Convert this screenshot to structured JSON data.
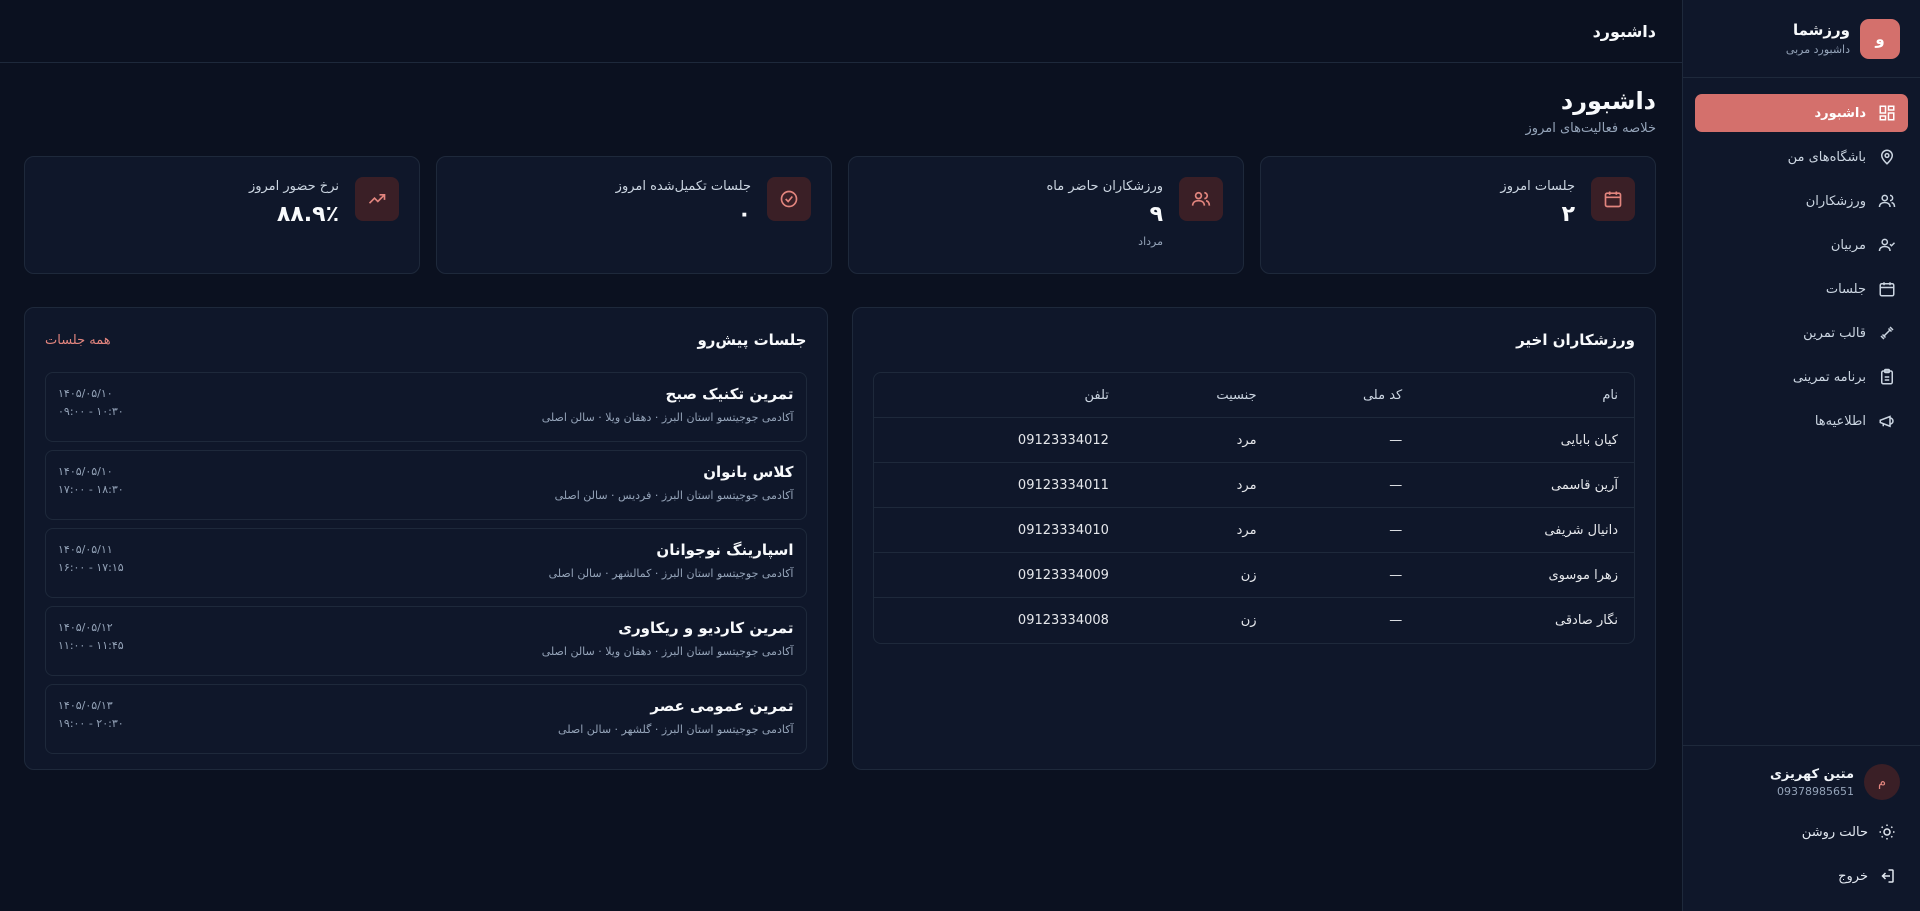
{
  "brand": {
    "name": "ورزشما",
    "subtitle": "داشبورد مربی",
    "logo_letter": "و"
  },
  "nav": [
    {
      "label": "داشبورد",
      "icon": "dashboard-grid-icon",
      "active": true
    },
    {
      "label": "باشگاه‌های من",
      "icon": "map-pin-icon"
    },
    {
      "label": "ورزشکاران",
      "icon": "users-icon"
    },
    {
      "label": "مربیان",
      "icon": "user-check-icon"
    },
    {
      "label": "جلسات",
      "icon": "calendar-icon"
    },
    {
      "label": "قالب تمرین",
      "icon": "dumbbell-icon"
    },
    {
      "label": "برنامه تمرینی",
      "icon": "clipboard-icon"
    },
    {
      "label": "اطلاعیه‌ها",
      "icon": "megaphone-icon"
    }
  ],
  "user": {
    "avatar_letter": "م",
    "name": "متین کهریزی",
    "phone": "09378985651"
  },
  "footer": {
    "theme_label": "حالت روشن",
    "logout_label": "خروج"
  },
  "topbar": {
    "title": "داشبورد"
  },
  "page": {
    "title": "داشبورد",
    "subtitle": "خلاصه فعالیت‌های امروز"
  },
  "stats": [
    {
      "label": "جلسات امروز",
      "value": "۲",
      "note": "",
      "icon": "calendar-icon"
    },
    {
      "label": "ورزشکاران حاضر ماه",
      "value": "۹",
      "note": "مرداد",
      "icon": "users-icon"
    },
    {
      "label": "جلسات تکمیل‌شده امروز",
      "value": "۰",
      "note": "",
      "icon": "check-circle-icon"
    },
    {
      "label": "نرخ حضور امروز",
      "value": "۸۸.۹٪",
      "note": "",
      "icon": "trending-up-icon"
    }
  ],
  "athletes": {
    "title": "ورزشکاران اخیر",
    "columns": [
      "نام",
      "کد ملی",
      "جنسیت",
      "تلفن"
    ],
    "rows": [
      [
        "کیان بابایی",
        "—",
        "مرد",
        "09123334012"
      ],
      [
        "آرین قاسمی",
        "—",
        "مرد",
        "09123334011"
      ],
      [
        "دانیال شریفی",
        "—",
        "مرد",
        "09123334010"
      ],
      [
        "زهرا موسوی",
        "—",
        "زن",
        "09123334009"
      ],
      [
        "نگار صادقی",
        "—",
        "زن",
        "09123334008"
      ]
    ]
  },
  "sessions": {
    "title": "جلسات پیش‌رو",
    "all_link": "همه جلسات",
    "items": [
      {
        "title": "تمرین تکنیک صبح",
        "location": "آکادمی جوجیتسو استان البرز · دهقان ویلا · سالن اصلی",
        "date": "۱۴۰۵/۰۵/۱۰",
        "time": "۰۹:۰۰ - ۱۰:۳۰"
      },
      {
        "title": "کلاس بانوان",
        "location": "آکادمی جوجیتسو استان البرز · فردیس · سالن اصلی",
        "date": "۱۴۰۵/۰۵/۱۰",
        "time": "۱۷:۰۰ - ۱۸:۳۰"
      },
      {
        "title": "اسپارینگ نوجوانان",
        "location": "آکادمی جوجیتسو استان البرز · کمالشهر · سالن اصلی",
        "date": "۱۴۰۵/۰۵/۱۱",
        "time": "۱۶:۰۰ - ۱۷:۱۵"
      },
      {
        "title": "تمرین کاردیو و ریکاوری",
        "location": "آکادمی جوجیتسو استان البرز · دهقان ویلا · سالن اصلی",
        "date": "۱۴۰۵/۰۵/۱۲",
        "time": "۱۱:۰۰ - ۱۱:۴۵"
      },
      {
        "title": "تمرین عمومی عصر",
        "location": "آکادمی جوجیتسو استان البرز · گلشهر · سالن اصلی",
        "date": "۱۴۰۵/۰۵/۱۳",
        "time": "۱۹:۰۰ - ۲۰:۳۰"
      }
    ]
  },
  "colors": {
    "accent": "#d4706c",
    "background": "#0b1120",
    "panel": "#0f172a",
    "border": "#1e293b"
  }
}
